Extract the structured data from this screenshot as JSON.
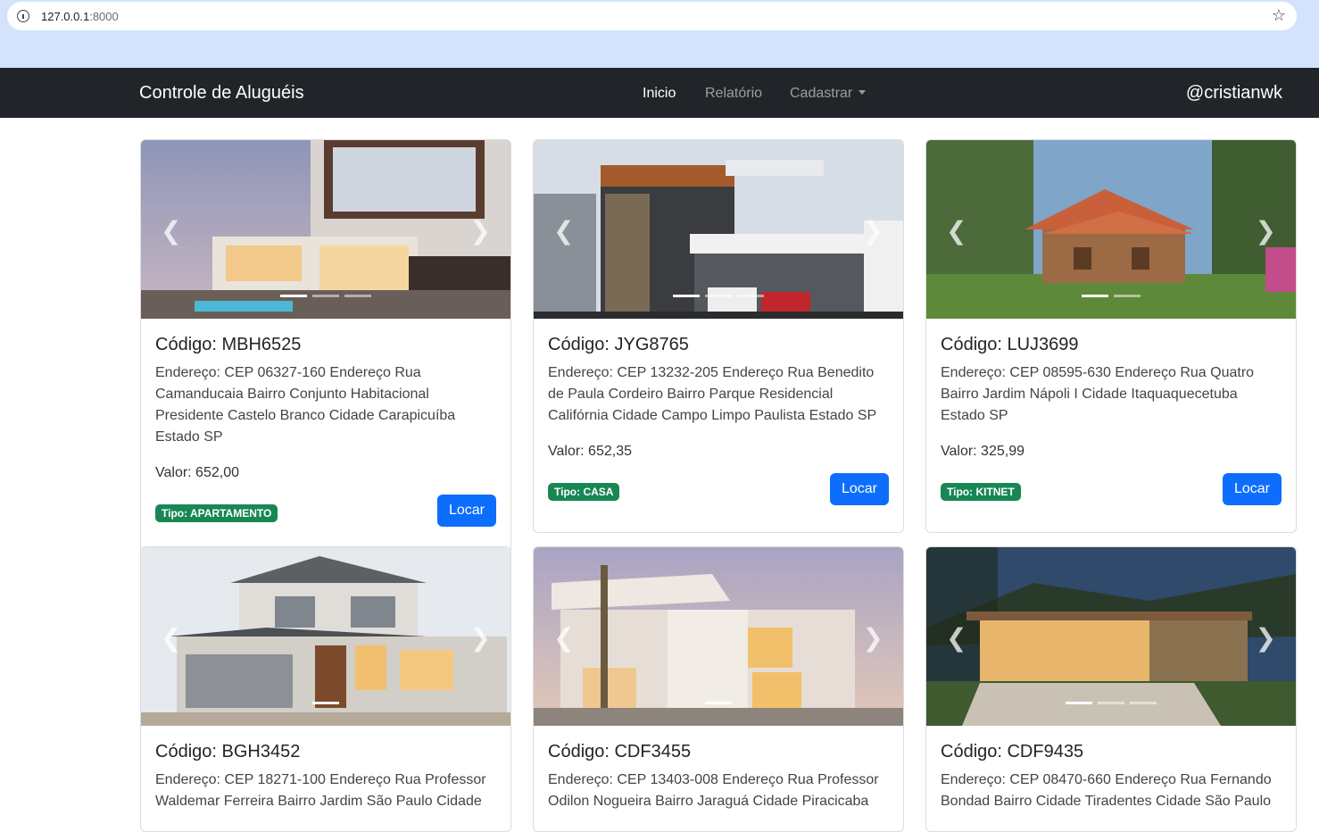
{
  "browser": {
    "host": "127.0.0.1",
    "port": ":8000"
  },
  "navbar": {
    "brand": "Controle de Aluguéis",
    "links": [
      "Inicio",
      "Relatório",
      "Cadastrar"
    ],
    "user": "@cristianwk"
  },
  "cards": [
    {
      "codigo": "Código: MBH6525",
      "endereco": "Endereço: CEP 06327-160 Endereço Rua Camanducaia Bairro Conjunto Habitacional Presidente Castelo Branco Cidade Carapicuíba Estado SP",
      "valor": "Valor: 652,00",
      "tipo": "Tipo: APARTAMENTO",
      "botao": "Locar"
    },
    {
      "codigo": "Código: JYG8765",
      "endereco": "Endereço: CEP 13232-205 Endereço Rua Benedito de Paula Cordeiro Bairro Parque Residencial Califórnia Cidade Campo Limpo Paulista Estado SP",
      "valor": "Valor: 652,35",
      "tipo": "Tipo: CASA",
      "botao": "Locar"
    },
    {
      "codigo": "Código: LUJ3699",
      "endereco": "Endereço: CEP 08595-630 Endereço Rua Quatro Bairro Jardim Nápoli I Cidade Itaquaquecetuba Estado SP",
      "valor": "Valor: 325,99",
      "tipo": "Tipo: KITNET",
      "botao": "Locar"
    },
    {
      "codigo": "Código: BGH3452",
      "endereco": "Endereço: CEP 18271-100 Endereço Rua Professor Waldemar Ferreira Bairro Jardim São Paulo Cidade"
    },
    {
      "codigo": "Código: CDF3455",
      "endereco": "Endereço: CEP 13403-008 Endereço Rua Professor Odilon Nogueira Bairro Jaraguá Cidade Piracicaba"
    },
    {
      "codigo": "Código: CDF9435",
      "endereco": "Endereço: CEP 08470-660 Endereço Rua Fernando Bondad Bairro Cidade Tiradentes Cidade São Paulo"
    }
  ],
  "colors": {
    "navbar": "#212529",
    "primary": "#0d6efd",
    "success": "#198754",
    "chrome": "#d3e3fd"
  }
}
